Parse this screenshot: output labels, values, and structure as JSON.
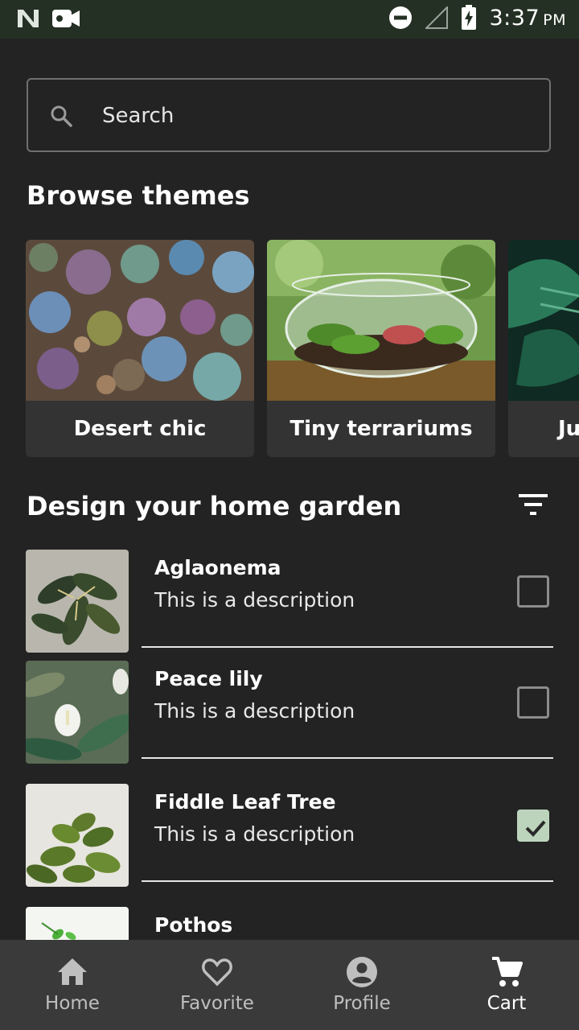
{
  "status_bar": {
    "time": "3:37",
    "ampm": "PM",
    "icons": [
      "n-logo-icon",
      "video-camera-icon",
      "do-not-disturb-icon",
      "no-signal-icon",
      "battery-charging-icon"
    ]
  },
  "search": {
    "placeholder": "Search",
    "icon": "search-icon"
  },
  "browse_themes": {
    "title": "Browse themes",
    "themes": [
      {
        "label": "Desert chic"
      },
      {
        "label": "Tiny terrariums"
      },
      {
        "label": "Ju"
      }
    ]
  },
  "garden": {
    "title": "Design your home garden",
    "filter_icon": "filter-icon",
    "plants": [
      {
        "name": "Aglaonema",
        "description": "This is a description",
        "checked": false
      },
      {
        "name": "Peace lily",
        "description": "This is a description",
        "checked": false
      },
      {
        "name": "Fiddle Leaf Tree",
        "description": "This is a description",
        "checked": true
      },
      {
        "name": "Pothos",
        "description": "",
        "checked": false
      }
    ]
  },
  "bottom_nav": {
    "items": [
      {
        "label": "Home",
        "icon": "home-icon"
      },
      {
        "label": "Favorite",
        "icon": "heart-icon"
      },
      {
        "label": "Profile",
        "icon": "account-icon"
      },
      {
        "label": "Cart",
        "icon": "cart-icon"
      }
    ],
    "active": "Cart"
  },
  "colors": {
    "background": "#232323",
    "status_bar": "#233023",
    "card": "#333333",
    "bottom_nav": "#3a3a3a",
    "checkbox_checked": "#bcd4bc"
  }
}
